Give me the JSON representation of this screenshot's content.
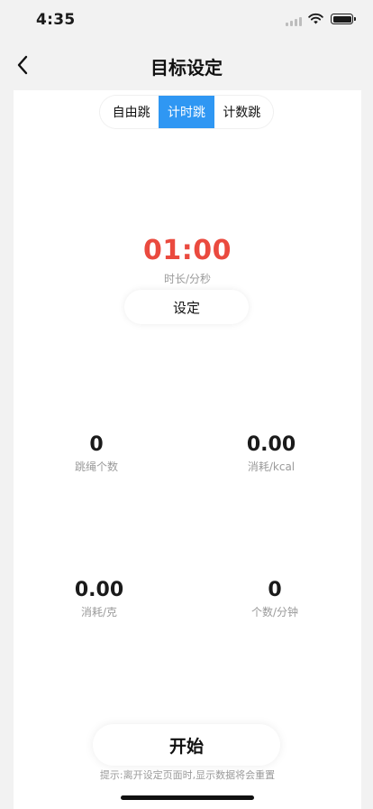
{
  "status_bar": {
    "time": "4:35"
  },
  "nav": {
    "title": "目标设定"
  },
  "modes": [
    {
      "label": "自由跳",
      "active": false
    },
    {
      "label": "计时跳",
      "active": true
    },
    {
      "label": "计数跳",
      "active": false
    }
  ],
  "timer": {
    "value": "01:00",
    "label": "时长/分秒",
    "set_label": "设定"
  },
  "stats": [
    {
      "value": "0",
      "label": "跳绳个数"
    },
    {
      "value": "0.00",
      "label": "消耗/kcal"
    },
    {
      "value": "0.00",
      "label": "消耗/克"
    },
    {
      "value": "0",
      "label": "个数/分钟"
    }
  ],
  "start_label": "开始",
  "hint": "提示:离开设定页面时,显示数据将会重置",
  "colors": {
    "accent": "#2f97f3",
    "timer": "#ea4a3f",
    "background": "#f2f2f2"
  },
  "icons": [
    "signal-icon",
    "wifi-icon",
    "battery-icon",
    "back-arrow-icon"
  ]
}
